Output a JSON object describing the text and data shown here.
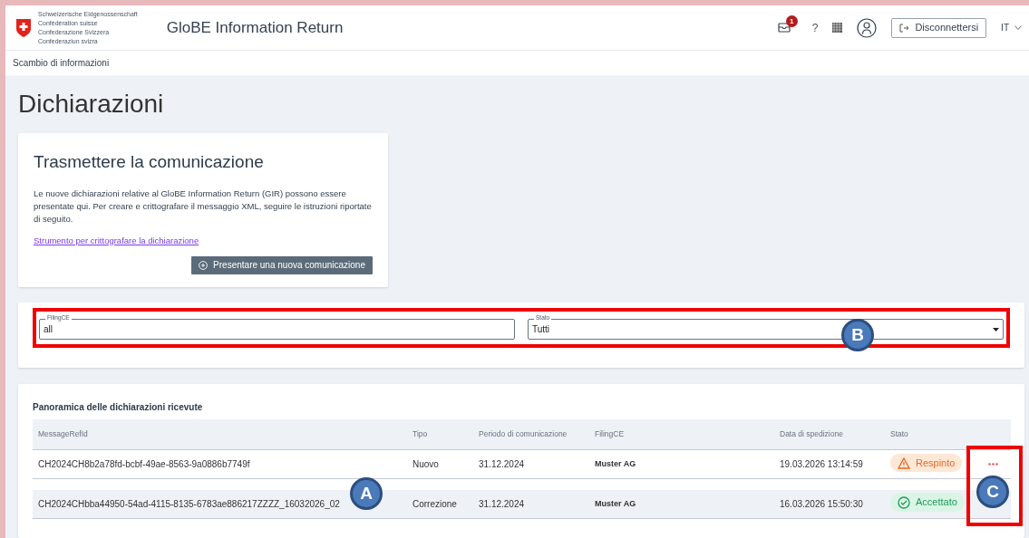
{
  "header": {
    "logo_lines": [
      "Schweizerische Eidgenossenschaft",
      "Confédération suisse",
      "Confederazione Svizzera",
      "Confederaziun svizra"
    ],
    "app_title": "GloBE Information Return",
    "notification_count": "1",
    "help": "?",
    "logout": "Disconnettersi",
    "language": "IT"
  },
  "breadcrumb": "Scambio di informazioni",
  "page_title": "Dichiarazioni",
  "submit_card": {
    "title": "Trasmettere la comunicazione",
    "text": "Le nuove dichiarazioni relative al GloBE Information Return (GIR) possono essere presentate qui. Per creare e crittografare il messaggio XML, seguire le istruzioni riportate di seguito.",
    "link": "Strumento per crittografare la dichiarazione",
    "button": "Presentare una nuova comunicazione"
  },
  "filters": [
    {
      "label": "FilingCE",
      "value": "all",
      "kind": "text"
    },
    {
      "label": "Stato",
      "value": "Tutti",
      "kind": "select"
    }
  ],
  "table": {
    "title": "Panoramica delle dichiarazioni ricevute",
    "columns": [
      "MessageRefId",
      "Tipo",
      "Periodo di comunicazione",
      "FilingCE",
      "Data di spedizione",
      "Stato"
    ],
    "rows": [
      {
        "cells": [
          "CH2024CH8b2a78fd-bcbf-49ae-8563-9a0886b7749f",
          "Nuovo",
          "31.12.2024",
          "Muster AG",
          "19.03.2026 13:14:59"
        ],
        "status": {
          "label": "Respinto",
          "kind": "rejected"
        },
        "selected": false
      },
      {
        "cells": [
          "CH2024CHbba44950-54ad-4115-8135-6783ae886217ZZZZ_16032026_02",
          "Correzione",
          "31.12.2024",
          "Muster AG",
          "16.03.2026 15:50:30"
        ],
        "status": {
          "label": "Accettato",
          "kind": "accepted"
        },
        "selected": true
      }
    ]
  },
  "annotations": [
    {
      "label": "A"
    },
    {
      "label": "B"
    },
    {
      "label": "C"
    }
  ]
}
